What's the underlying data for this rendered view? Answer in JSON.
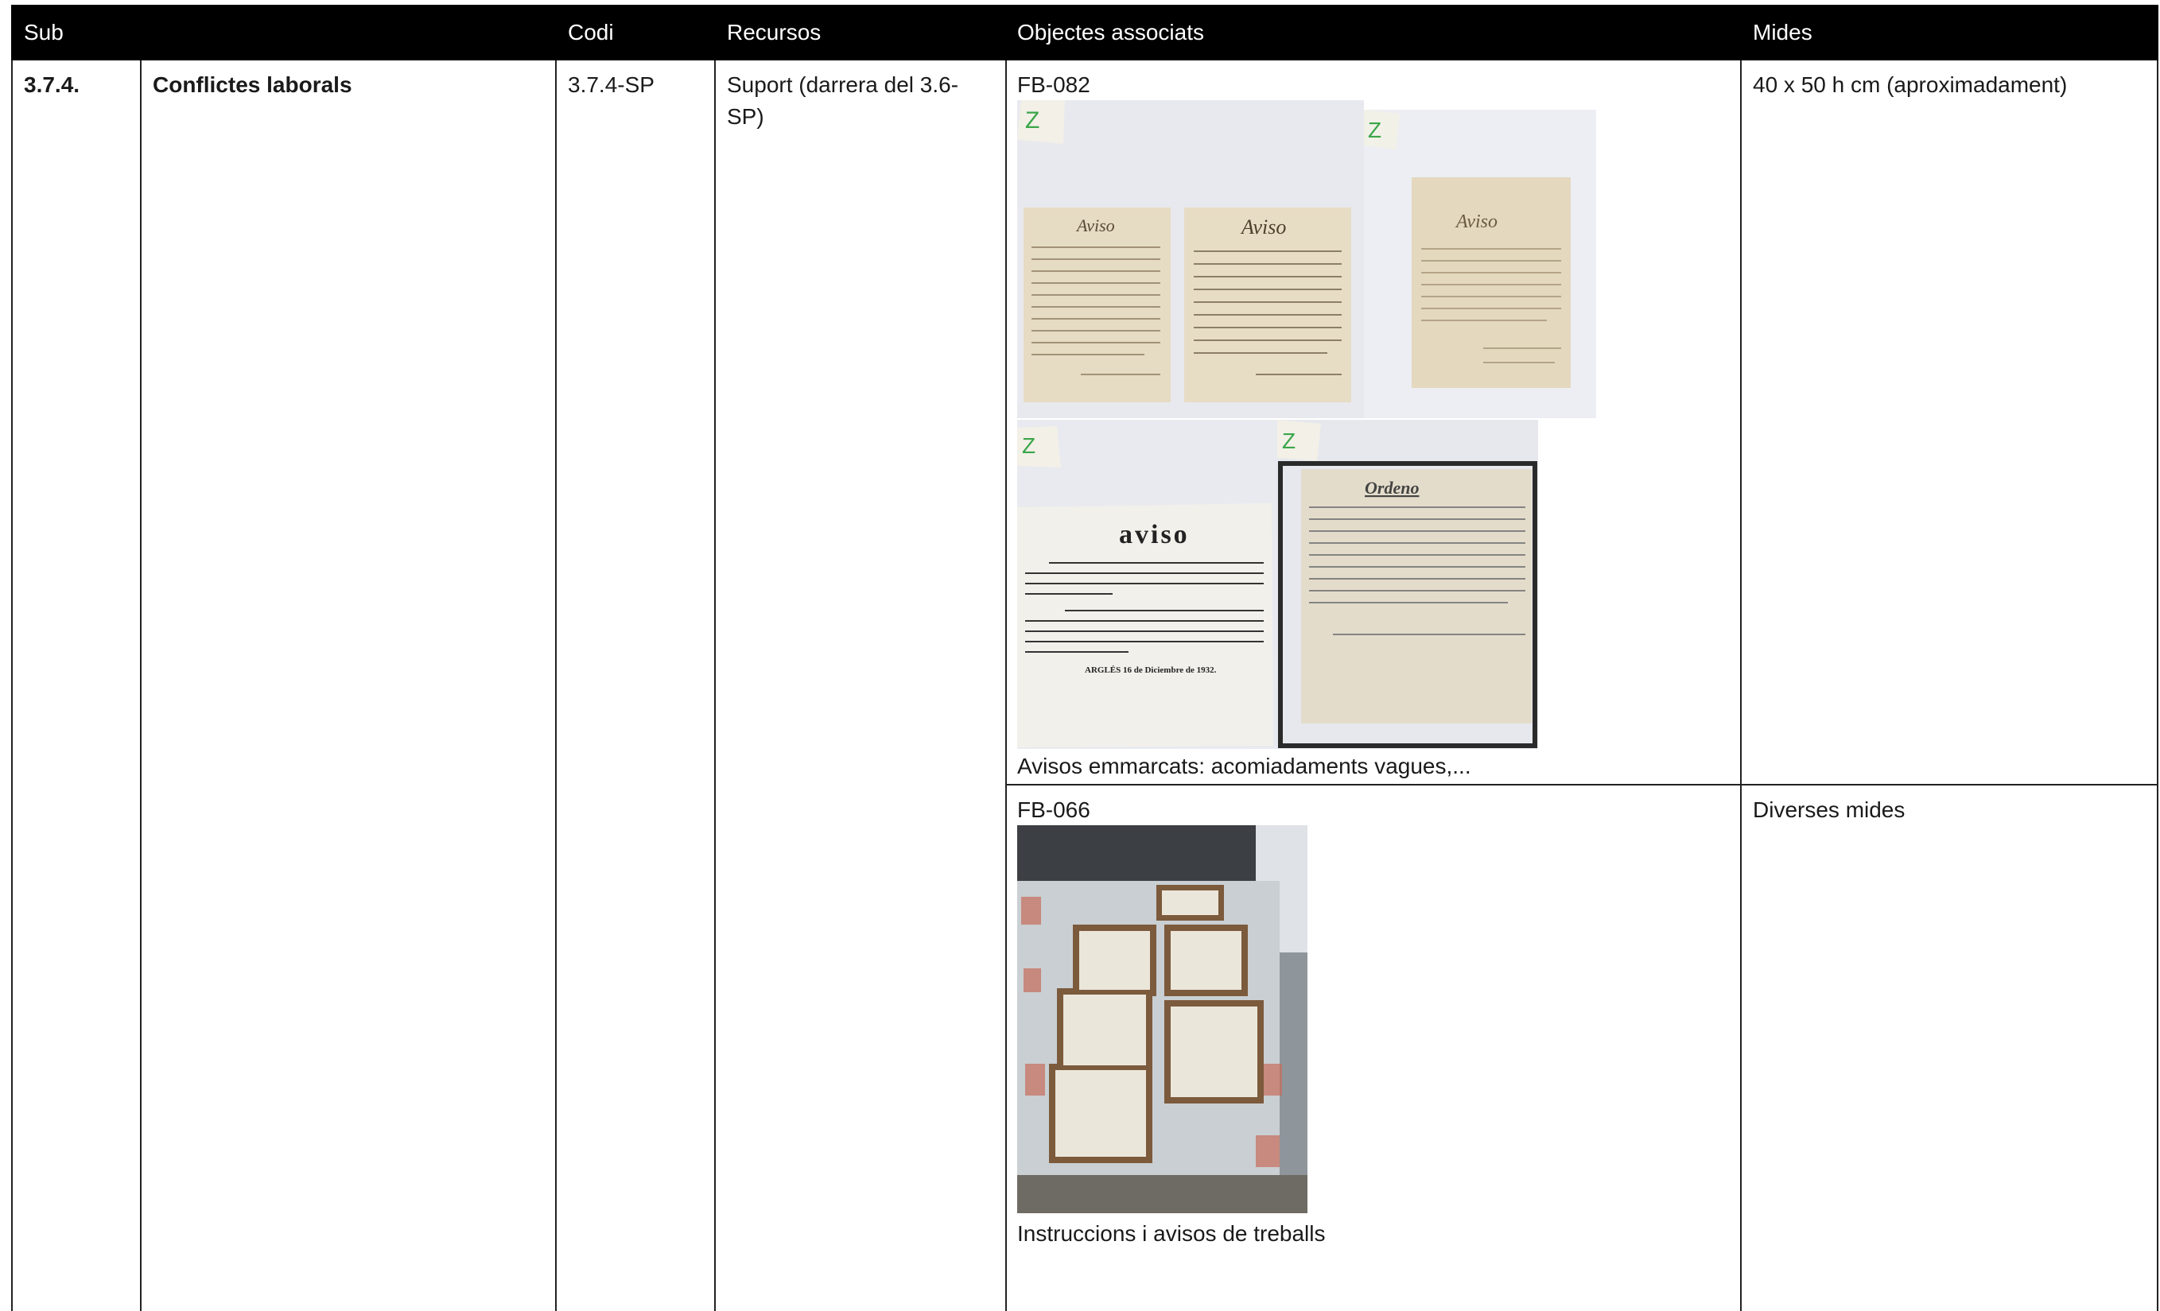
{
  "table": {
    "headers": {
      "sub": "Sub",
      "codi": "Codi",
      "recursos": "Recursos",
      "objectes": "Objectes associats",
      "mides": "Mides"
    },
    "row": {
      "sub": "3.7.4.",
      "title": "Conflictes laborals",
      "codi": "3.7.4-SP",
      "recursos": "Suport (darrera del 3.6-SP)"
    },
    "objects": [
      {
        "id": "FB-082",
        "caption": "Avisos emmarcats: acomiadaments vagues,...",
        "mides": "40 x 50 h cm (aproximadament)",
        "photo_tags": [
          "Z",
          "Z",
          "Z",
          "Z"
        ],
        "notice_titles": [
          "Aviso",
          "Aviso",
          "Aviso",
          "aviso",
          "Ordeno"
        ],
        "notice_footer": "ARGLÉS 16 de Diciembre de 1932."
      },
      {
        "id": "FB-066",
        "caption": "Instruccions i avisos de treballs",
        "mides": "Diverses mides"
      }
    ]
  }
}
